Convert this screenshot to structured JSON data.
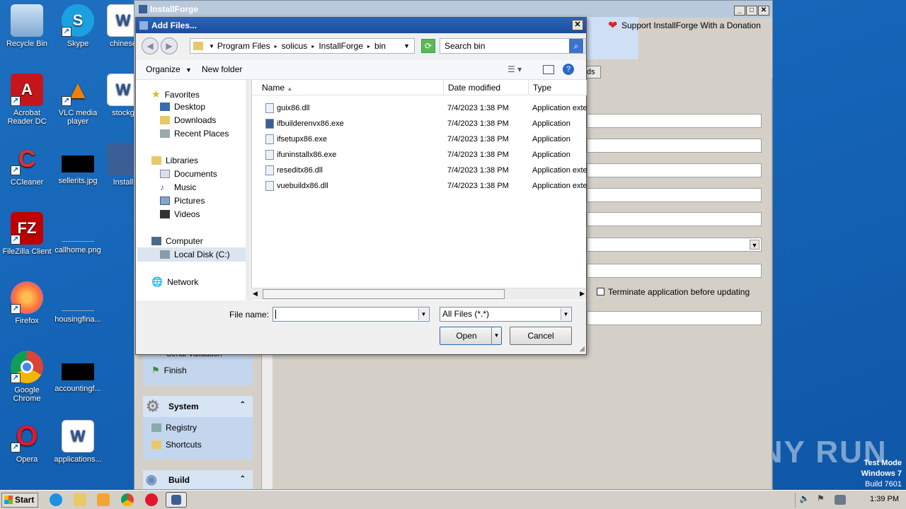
{
  "desktop": {
    "icons": [
      {
        "label": "Recycle Bin"
      },
      {
        "label": "Skype"
      },
      {
        "label": "chinese"
      },
      {
        "label": "Acrobat Reader DC"
      },
      {
        "label": "VLC media player"
      },
      {
        "label": "stockg"
      },
      {
        "label": "CCleaner"
      },
      {
        "label": "sellerits.jpg"
      },
      {
        "label": "Install"
      },
      {
        "label": "FileZilla Client"
      },
      {
        "label": "callhome.png"
      },
      {
        "label": "Firefox"
      },
      {
        "label": "housingfina..."
      },
      {
        "label": "Google Chrome"
      },
      {
        "label": "accountingf..."
      },
      {
        "label": "Opera"
      },
      {
        "label": "applications..."
      }
    ],
    "watermark": "ANY  RUN",
    "test_mode": {
      "line1": "Test Mode",
      "line2": "Windows 7",
      "line3": "Build 7601"
    }
  },
  "main_window": {
    "title": "InstallForge",
    "support_text": "Support InstallForge With a Donation",
    "tab_fragment": "ds",
    "terminate_label": "Terminate application before updating",
    "nav": {
      "partial_item": "Serial Validation",
      "finish": "Finish",
      "system_header": "System",
      "registry": "Registry",
      "shortcuts": "Shortcuts",
      "build_header": "Build"
    }
  },
  "dialog": {
    "title": "Add Files...",
    "close": "✕",
    "breadcrumb": [
      "Program Files",
      "solicus",
      "InstallForge",
      "bin"
    ],
    "search_placeholder": "Search bin",
    "toolbar": {
      "organize": "Organize",
      "new_folder": "New folder"
    },
    "tree": {
      "favorites": "Favorites",
      "desktop": "Desktop",
      "downloads": "Downloads",
      "recent": "Recent Places",
      "libraries": "Libraries",
      "documents": "Documents",
      "music": "Music",
      "pictures": "Pictures",
      "videos": "Videos",
      "computer": "Computer",
      "local_disk": "Local Disk (C:)",
      "network": "Network"
    },
    "columns": {
      "name": "Name",
      "date": "Date modified",
      "type": "Type"
    },
    "files": [
      {
        "name": "guix86.dll",
        "date": "7/4/2023 1:38 PM",
        "type": "Application exte"
      },
      {
        "name": "ifbuilderenvx86.exe",
        "date": "7/4/2023 1:38 PM",
        "type": "Application"
      },
      {
        "name": "ifsetupx86.exe",
        "date": "7/4/2023 1:38 PM",
        "type": "Application"
      },
      {
        "name": "ifuninstallx86.exe",
        "date": "7/4/2023 1:38 PM",
        "type": "Application"
      },
      {
        "name": "reseditx86.dll",
        "date": "7/4/2023 1:38 PM",
        "type": "Application exte"
      },
      {
        "name": "vuebuildx86.dll",
        "date": "7/4/2023 1:38 PM",
        "type": "Application exte"
      }
    ],
    "file_name_label": "File name:",
    "file_name_value": "",
    "filter": "All Files (*.*)",
    "open": "Open",
    "cancel": "Cancel"
  },
  "taskbar": {
    "start": "Start",
    "clock": "1:39 PM"
  }
}
